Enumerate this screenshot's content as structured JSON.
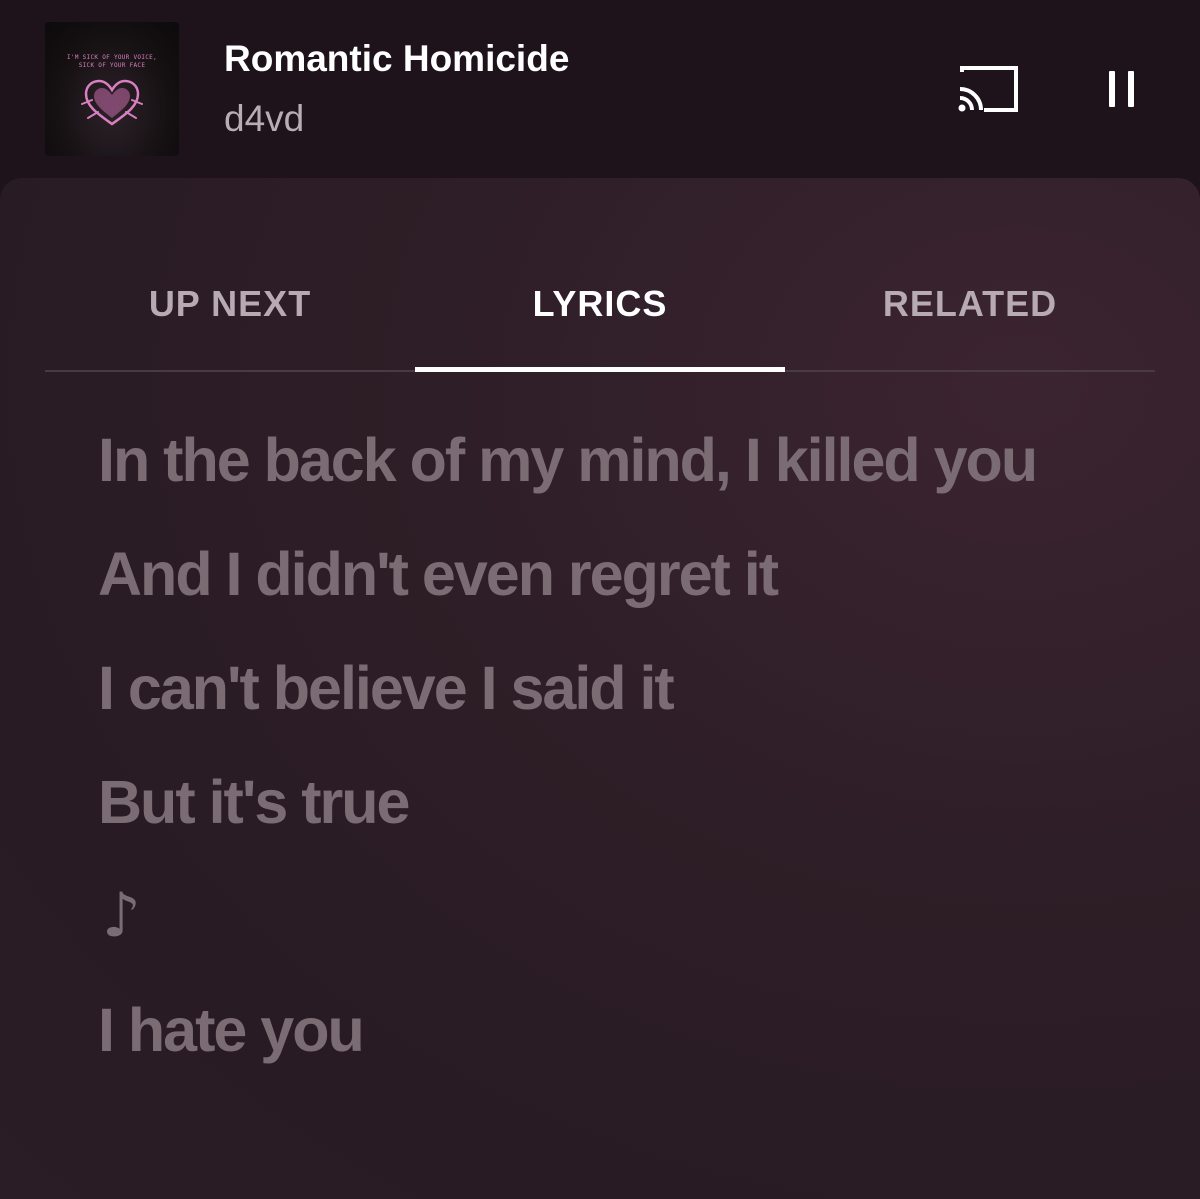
{
  "now_playing": {
    "title": "Romantic Homicide",
    "artist": "d4vd",
    "album_art": {
      "text_line1": "I'M SICK OF YOUR VOICE,",
      "text_line2": "SICK OF YOUR FACE",
      "icon": "heart-hands-icon",
      "accent_color": "#d77fc0"
    }
  },
  "controls": {
    "cast_icon": "cast-icon",
    "pause_icon": "pause-icon"
  },
  "tabs": [
    {
      "label": "UP NEXT",
      "active": false
    },
    {
      "label": "LYRICS",
      "active": true
    },
    {
      "label": "RELATED",
      "active": false
    }
  ],
  "lyrics": [
    "In the back of my mind, I killed you",
    "And I didn't even regret it",
    "I can't believe I said it",
    "But it's true",
    "♪",
    "I hate you"
  ],
  "colors": {
    "header_bg": "#1e131b",
    "sheet_bg": "#2e1e27",
    "lyric_text": "#7b6c74",
    "active_tab": "#ffffff",
    "inactive_tab": "#b7aab2"
  }
}
